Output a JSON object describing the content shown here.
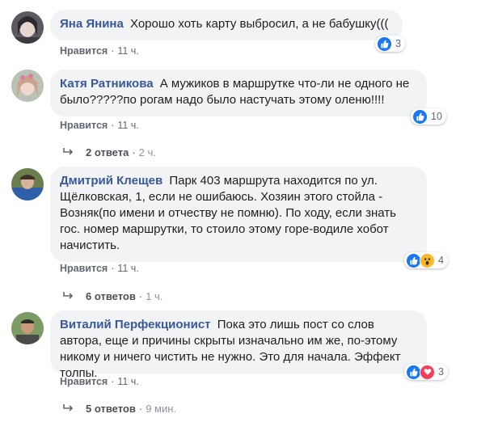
{
  "like_label": "Нравится",
  "comments": [
    {
      "author": "Яна Янина",
      "text": "Хорошо хоть карту выбросил, а не бабушку(((",
      "time": "11 ч.",
      "reaction_count": "3",
      "reactions": [
        "like"
      ]
    },
    {
      "author": "Катя Ратникова",
      "text": "А мужиков в маршрутке что-ли не одного не было?????по рогам надо было настучать этому оленю!!!!",
      "time": "11 ч.",
      "reaction_count": "10",
      "reactions": [
        "like"
      ],
      "replies_label": "2 ответа",
      "replies_time": "2 ч."
    },
    {
      "author": "Дмитрий Клещев",
      "text": "Парк 403 маршрута находится по ул. Щёлковская, 1, если не ошибаюсь. Хозяин этого стойла - Возняк(по имени и отчеству не помню). По ходу, если знать гос. номер маршрутки, то стоило этому горе-водиле хобот начистить.",
      "time": "11 ч.",
      "reaction_count": "4",
      "reactions": [
        "like",
        "wow"
      ],
      "replies_label": "6 ответов",
      "replies_time": "1 ч."
    },
    {
      "author": "Виталий Перфекционист",
      "text": "Пока это лишь пост со слов автора, еще и причины скрыты изначально им же, по-этому никому и ничего чистить не нужно. Это для начала. Эффект толпы.",
      "time": "11 ч.",
      "reaction_count": "3",
      "reactions": [
        "like",
        "love"
      ],
      "replies_label": "5 ответов",
      "replies_time": "9 мин."
    }
  ],
  "colors": {
    "author": "#385898",
    "bubble": "#f2f3f5",
    "like": "#1877f2",
    "wow": "#f7b928",
    "love": "#f33e58"
  }
}
